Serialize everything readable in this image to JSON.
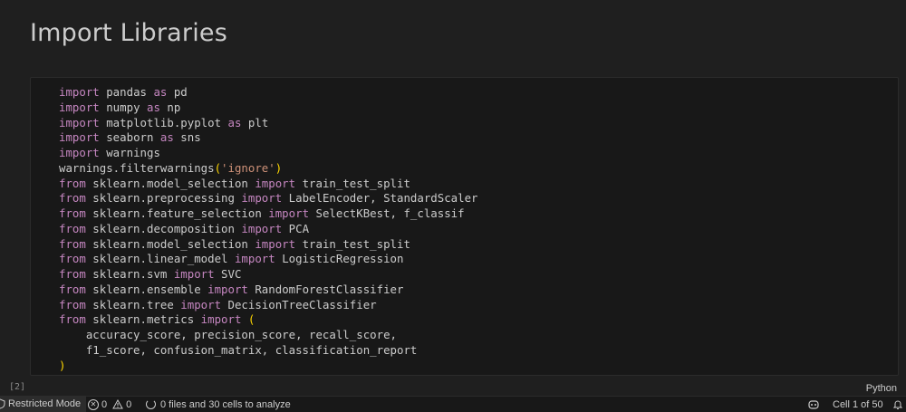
{
  "markdown": {
    "heading": "Import Libraries"
  },
  "code_cell": {
    "execution_count": "[2]",
    "language": "Python",
    "lines": [
      [
        {
          "t": "kw",
          "v": "import"
        },
        {
          "t": "tx",
          "v": " pandas "
        },
        {
          "t": "kw",
          "v": "as"
        },
        {
          "t": "tx",
          "v": " pd"
        }
      ],
      [
        {
          "t": "kw",
          "v": "import"
        },
        {
          "t": "tx",
          "v": " numpy "
        },
        {
          "t": "kw",
          "v": "as"
        },
        {
          "t": "tx",
          "v": " np"
        }
      ],
      [
        {
          "t": "kw",
          "v": "import"
        },
        {
          "t": "tx",
          "v": " matplotlib.pyplot "
        },
        {
          "t": "kw",
          "v": "as"
        },
        {
          "t": "tx",
          "v": " plt"
        }
      ],
      [
        {
          "t": "kw",
          "v": "import"
        },
        {
          "t": "tx",
          "v": " seaborn "
        },
        {
          "t": "kw",
          "v": "as"
        },
        {
          "t": "tx",
          "v": " sns"
        }
      ],
      [
        {
          "t": "kw",
          "v": "import"
        },
        {
          "t": "tx",
          "v": " warnings"
        }
      ],
      [
        {
          "t": "tx",
          "v": "warnings.filterwarnings"
        },
        {
          "t": "br",
          "v": "("
        },
        {
          "t": "str",
          "v": "'ignore'"
        },
        {
          "t": "br",
          "v": ")"
        }
      ],
      [
        {
          "t": "kw",
          "v": "from"
        },
        {
          "t": "tx",
          "v": " sklearn.model_selection "
        },
        {
          "t": "kw",
          "v": "import"
        },
        {
          "t": "tx",
          "v": " train_test_split"
        }
      ],
      [
        {
          "t": "kw",
          "v": "from"
        },
        {
          "t": "tx",
          "v": " sklearn.preprocessing "
        },
        {
          "t": "kw",
          "v": "import"
        },
        {
          "t": "tx",
          "v": " LabelEncoder, StandardScaler"
        }
      ],
      [
        {
          "t": "kw",
          "v": "from"
        },
        {
          "t": "tx",
          "v": " sklearn.feature_selection "
        },
        {
          "t": "kw",
          "v": "import"
        },
        {
          "t": "tx",
          "v": " SelectKBest, f_classif"
        }
      ],
      [
        {
          "t": "kw",
          "v": "from"
        },
        {
          "t": "tx",
          "v": " sklearn.decomposition "
        },
        {
          "t": "kw",
          "v": "import"
        },
        {
          "t": "tx",
          "v": " PCA"
        }
      ],
      [
        {
          "t": "kw",
          "v": "from"
        },
        {
          "t": "tx",
          "v": " sklearn.model_selection "
        },
        {
          "t": "kw",
          "v": "import"
        },
        {
          "t": "tx",
          "v": " train_test_split"
        }
      ],
      [
        {
          "t": "kw",
          "v": "from"
        },
        {
          "t": "tx",
          "v": " sklearn.linear_model "
        },
        {
          "t": "kw",
          "v": "import"
        },
        {
          "t": "tx",
          "v": " LogisticRegression"
        }
      ],
      [
        {
          "t": "kw",
          "v": "from"
        },
        {
          "t": "tx",
          "v": " sklearn.svm "
        },
        {
          "t": "kw",
          "v": "import"
        },
        {
          "t": "tx",
          "v": " SVC"
        }
      ],
      [
        {
          "t": "kw",
          "v": "from"
        },
        {
          "t": "tx",
          "v": " sklearn.ensemble "
        },
        {
          "t": "kw",
          "v": "import"
        },
        {
          "t": "tx",
          "v": " RandomForestClassifier"
        }
      ],
      [
        {
          "t": "kw",
          "v": "from"
        },
        {
          "t": "tx",
          "v": " sklearn.tree "
        },
        {
          "t": "kw",
          "v": "import"
        },
        {
          "t": "tx",
          "v": " DecisionTreeClassifier"
        }
      ],
      [
        {
          "t": "kw",
          "v": "from"
        },
        {
          "t": "tx",
          "v": " sklearn.metrics "
        },
        {
          "t": "kw",
          "v": "import"
        },
        {
          "t": "tx",
          "v": " "
        },
        {
          "t": "br",
          "v": "("
        }
      ],
      [
        {
          "t": "tx",
          "v": "    accuracy_score, precision_score, recall_score,"
        }
      ],
      [
        {
          "t": "tx",
          "v": "    f1_score, confusion_matrix, classification_report"
        }
      ],
      [
        {
          "t": "br",
          "v": ")"
        }
      ]
    ]
  },
  "status_bar": {
    "restricted_mode": "Restricted Mode",
    "errors": "0",
    "warnings": "0",
    "analysis": "0 files and 30 cells to analyze",
    "cell_position": "Cell 1 of 50",
    "icons": {
      "shield": "shield-icon",
      "error": "error-icon",
      "warning": "warning-icon",
      "spinner": "loading-spinner-icon",
      "copilot": "copilot-icon",
      "bell": "notification-bell-icon"
    }
  },
  "colors": {
    "background": "#1f1f1f",
    "cell_background": "#181818",
    "keyword": "#c586c0",
    "string": "#ce9178",
    "bracket": "#ffd700",
    "text": "#cccccc"
  }
}
